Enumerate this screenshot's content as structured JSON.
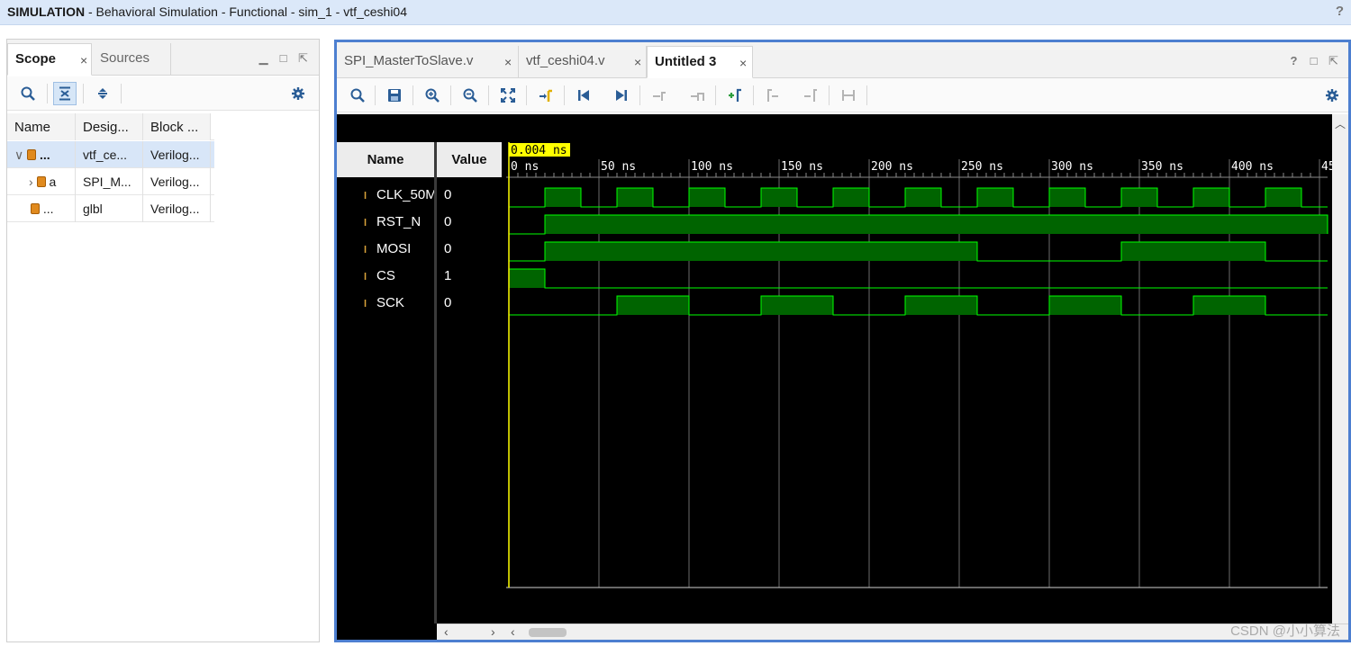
{
  "title": {
    "bold": "SIMULATION",
    "rest": " - Behavioral Simulation - Functional - sim_1 - vtf_ceshi04",
    "help": "?"
  },
  "left": {
    "tabs": [
      {
        "label": "Scope",
        "active": true
      },
      {
        "label": "Sources",
        "active": false
      }
    ],
    "columns": [
      "Name",
      "Desig...",
      "Block ..."
    ],
    "rows": [
      {
        "name": "...",
        "design": "vtf_ce...",
        "block": "Verilog...",
        "expander": "∨",
        "selected": true
      },
      {
        "name": "a",
        "design": "SPI_M...",
        "block": "Verilog...",
        "expander": "›",
        "selected": false
      },
      {
        "name": "...",
        "design": "glbl",
        "block": "Verilog...",
        "expander": "",
        "selected": false
      }
    ]
  },
  "right": {
    "tabs": [
      {
        "label": "SPI_MasterToSlave.v",
        "active": false
      },
      {
        "label": "vtf_ceshi04.v",
        "active": false
      },
      {
        "label": "Untitled 3",
        "active": true
      }
    ],
    "name_header": "Name",
    "value_header": "Value",
    "cursor_label": "0.004 ns"
  },
  "icons": {
    "search": "search-icon",
    "collapse": "collapse-all-icon",
    "expand": "expand-all-icon",
    "settings": "gear-icon",
    "save": "save-icon",
    "zoom_in": "zoom-in-icon",
    "zoom_out": "zoom-out-icon",
    "zoom_fit": "zoom-fit-icon",
    "go_cursor": "go-to-cursor-icon",
    "go_start": "go-to-start-icon",
    "go_end": "go-to-end-icon"
  },
  "colors": {
    "wave_fill": "#006400",
    "wave_line": "#00ff00",
    "cursor": "#ffff00",
    "background": "#000000",
    "accent": "#4d7fd0"
  },
  "chart_data": {
    "type": "line",
    "title": "",
    "xlabel": "",
    "ylabel": "",
    "xlim": [
      0,
      455
    ],
    "x_ticks": [
      "0 ns",
      "50 ns",
      "100 ns",
      "150 ns",
      "200 ns",
      "250 ns",
      "300 ns",
      "350 ns",
      "400 ns",
      "45"
    ],
    "x_tick_values": [
      0,
      50,
      100,
      150,
      200,
      250,
      300,
      350,
      400,
      450
    ],
    "cursor_ns": 0.004,
    "signals": [
      {
        "name": "CLK_50M",
        "value": "0",
        "kind": "clock",
        "edges": [
          [
            20,
            40
          ],
          [
            60,
            80
          ],
          [
            100,
            120
          ],
          [
            140,
            160
          ],
          [
            180,
            200
          ],
          [
            220,
            240
          ],
          [
            260,
            280
          ],
          [
            300,
            320
          ],
          [
            340,
            360
          ],
          [
            380,
            400
          ],
          [
            420,
            440
          ]
        ]
      },
      {
        "name": "RST_N",
        "value": "0",
        "kind": "input",
        "edges": [
          [
            20,
            455
          ]
        ]
      },
      {
        "name": "MOSI",
        "value": "0",
        "kind": "output",
        "edges": [
          [
            20,
            260
          ],
          [
            340,
            420
          ]
        ]
      },
      {
        "name": "CS",
        "value": "1",
        "kind": "output",
        "edges": [
          [
            0,
            20
          ]
        ]
      },
      {
        "name": "SCK",
        "value": "0",
        "kind": "output",
        "edges": [
          [
            60,
            100
          ],
          [
            140,
            180
          ],
          [
            220,
            260
          ],
          [
            300,
            340
          ],
          [
            380,
            420
          ]
        ]
      }
    ]
  },
  "watermark": "CSDN @小小算法"
}
